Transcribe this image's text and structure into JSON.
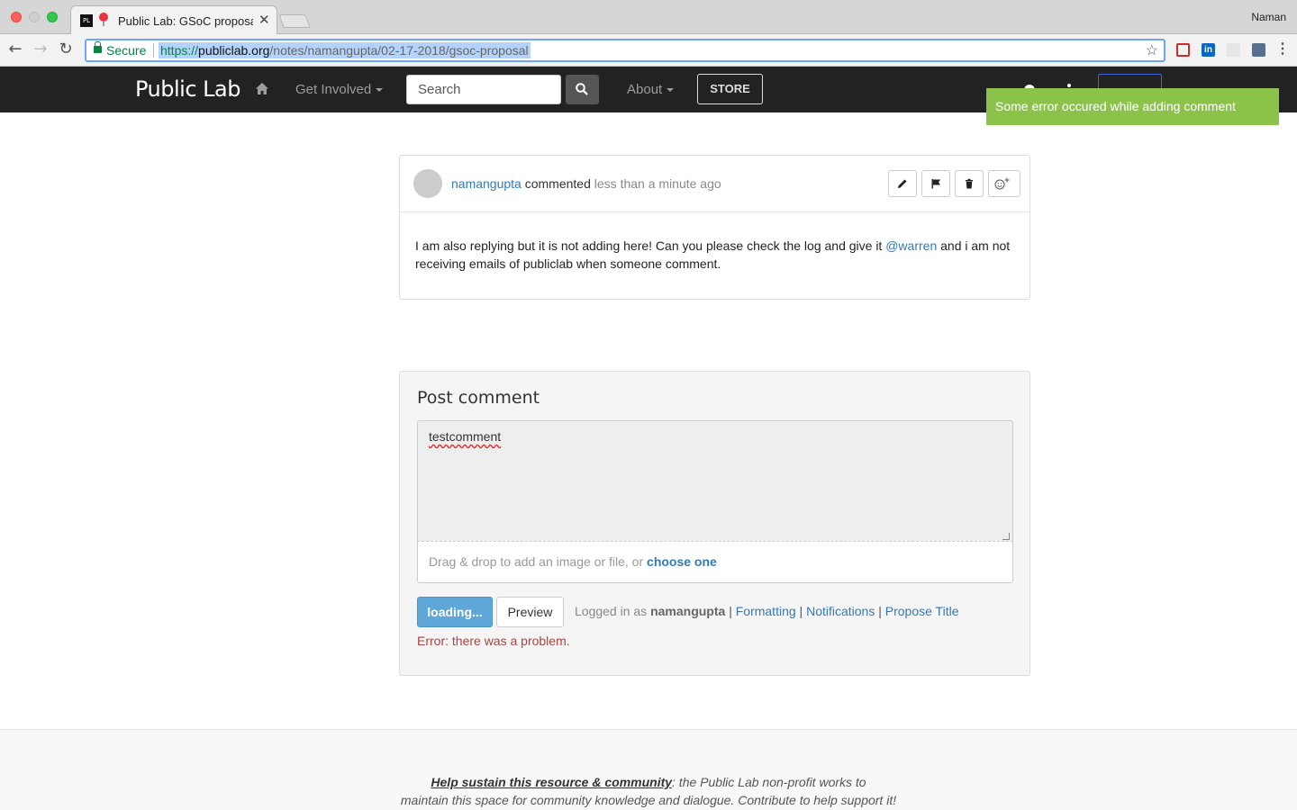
{
  "browser": {
    "tab_title": "Public Lab: GSoC proposal",
    "tab_favicon": "PL",
    "profile_name": "Naman",
    "secure_label": "Secure",
    "url_scheme": "https://",
    "url_host": "publiclab.org",
    "url_path": "/notes/namangupta/02-17-2018/gsoc-proposal"
  },
  "navbar": {
    "brand": "Public Lab",
    "get_involved": "Get Involved",
    "search_placeholder": "Search",
    "about": "About",
    "store": "STORE"
  },
  "notification": {
    "message": "Some error occured while adding comment",
    "color": "#8bc34a"
  },
  "comment": {
    "author": "namangupta",
    "action": "commented",
    "time": "less than a minute ago",
    "body_part1": "I am also replying but it is not adding here! Can you please check the log and give it ",
    "mention": "@warren",
    "body_part2": " and i am not receiving emails of publiclab when someone comment.",
    "actions": [
      "edit-icon",
      "flag-icon",
      "trash-icon",
      "emoji-add-icon"
    ]
  },
  "post_comment": {
    "title": "Post comment",
    "textarea_value": "testcomment",
    "drop_text": "Drag & drop to add an image or file, or ",
    "drop_link": "choose one",
    "submit_label": "loading...",
    "preview_label": "Preview",
    "logged_in_prefix": "Logged in as ",
    "username": "namangupta",
    "formatting": "Formatting",
    "notifications": "Notifications",
    "propose_title": "Propose Title",
    "error": "Error: there was a problem."
  },
  "footer": {
    "strong": "Help sustain this resource & community",
    "rest_line1": ": the Public Lab non-profit works to",
    "line2": "maintain this space for community knowledge and dialogue. Contribute to help support it!"
  }
}
